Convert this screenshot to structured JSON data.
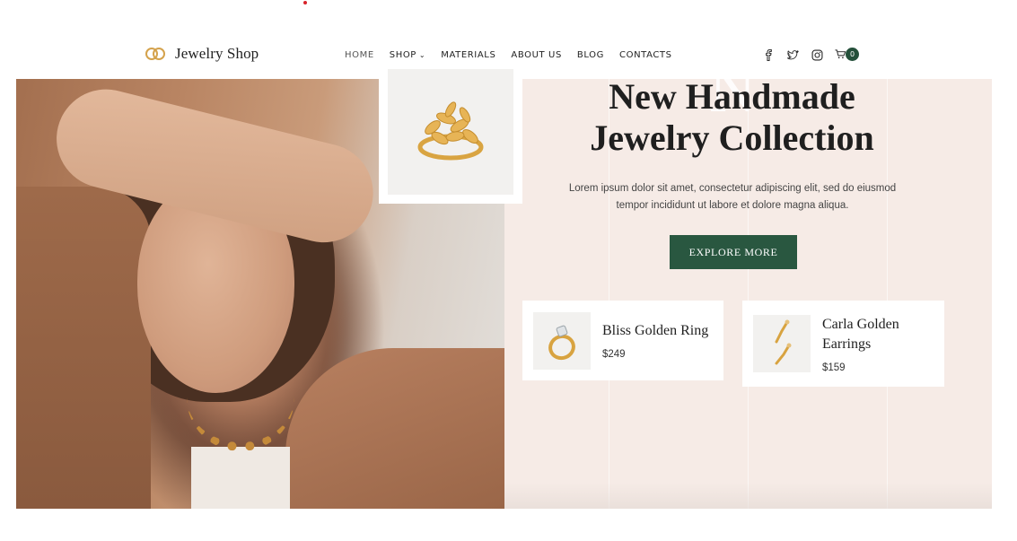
{
  "header": {
    "logo_text": "Jewelry Shop",
    "logo_icon": "interlocked-rings-logo",
    "nav": [
      {
        "label": "HOME",
        "active": true
      },
      {
        "label": "SHOP",
        "has_dropdown": true
      },
      {
        "label": "MATERIALS"
      },
      {
        "label": "ABOUT US"
      },
      {
        "label": "BLOG"
      },
      {
        "label": "CONTACTS"
      }
    ],
    "icons": [
      "facebook-icon",
      "twitter-icon",
      "instagram-icon",
      "cart-icon"
    ],
    "cart_count": "0",
    "accent_color": "#295740"
  },
  "hero": {
    "watermark": "N",
    "title_line1": "New Handmade",
    "title_line2": "Jewelry Collection",
    "description_line1": "Lorem ipsum dolor sit amet, consectetur adipiscing elit, sed do eiusmod",
    "description_line2": "tempor incididunt ut labore et dolore magna aliqua.",
    "cta_label": "EXPLORE MORE",
    "background_color": "#f6ebe6"
  },
  "products": [
    {
      "name": "Bliss Golden Ring",
      "price": "$249",
      "icon": "ring-icon"
    },
    {
      "name_line1": "Carla Golden",
      "name_line2": "Earrings",
      "price": "$159",
      "icon": "earrings-icon"
    }
  ]
}
